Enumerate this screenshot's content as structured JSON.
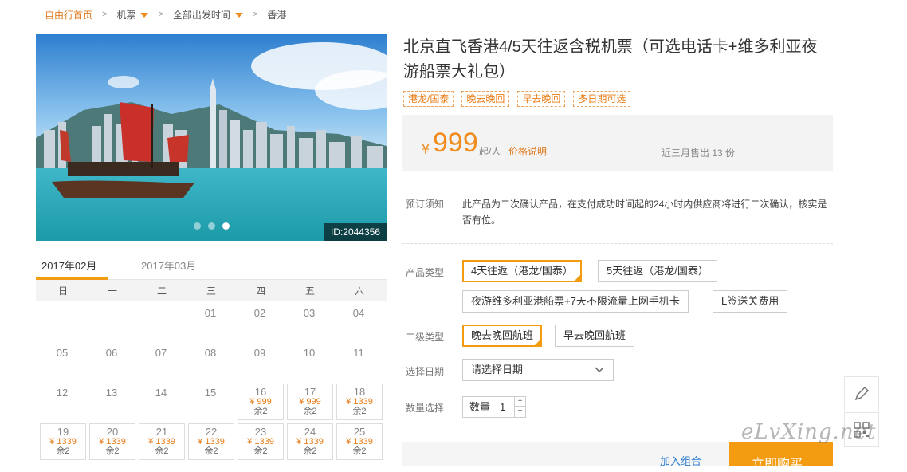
{
  "breadcrumb": {
    "home": "自由行首页",
    "flight": "机票",
    "departure": "全部出发时间",
    "destination": "香港"
  },
  "hero": {
    "id_label": "ID:2044356",
    "slides": 3,
    "active_slide": 3
  },
  "months": {
    "tabs": [
      "2017年02月",
      "2017年03月"
    ],
    "active": 0
  },
  "calendar": {
    "weekdays": [
      "日",
      "一",
      "二",
      "三",
      "四",
      "五",
      "六"
    ],
    "plain_days": [
      "01",
      "02",
      "03",
      "04",
      "05",
      "06",
      "07",
      "08",
      "09",
      "10",
      "11",
      "12",
      "13",
      "14",
      "15"
    ],
    "priced_days": [
      {
        "day": "16",
        "price": "¥ 999",
        "remain": "余2"
      },
      {
        "day": "17",
        "price": "¥ 999",
        "remain": "余2"
      },
      {
        "day": "18",
        "price": "¥ 1339",
        "remain": "余2"
      },
      {
        "day": "19",
        "price": "¥ 1339",
        "remain": "余2"
      },
      {
        "day": "20",
        "price": "¥ 1339",
        "remain": "余2"
      },
      {
        "day": "21",
        "price": "¥ 1339",
        "remain": "余2"
      },
      {
        "day": "22",
        "price": "¥ 1339",
        "remain": "余2"
      },
      {
        "day": "23",
        "price": "¥ 1339",
        "remain": "余2"
      },
      {
        "day": "24",
        "price": "¥ 1339",
        "remain": "余2"
      },
      {
        "day": "25",
        "price": "¥ 1339",
        "remain": "余2"
      }
    ]
  },
  "product": {
    "title": "北京直飞香港4/5天往返含税机票（可选电话卡+维多利亚夜游船票大礼包）",
    "tags": [
      "港龙/国泰",
      "晚去晚回",
      "早去晚回",
      "多日期可选"
    ],
    "price": {
      "currency": "¥",
      "amount": "999",
      "unit": "起/人",
      "note": "价格说明",
      "sold": "近三月售出 13 份"
    },
    "notice_label": "预订须知",
    "notice_text": "此产品为二次确认产品，在支付成功时间起的24小时内供应商将进行二次确认，核实是否有位。",
    "type_label": "产品类型",
    "types": [
      "4天往返（港龙/国泰）",
      "5天往返（港龙/国泰）",
      "夜游维多利亚港船票+7天不限流量上网手机卡",
      "L签送关费用"
    ],
    "subtype_label": "二级类型",
    "subtypes": [
      "晚去晚回航班",
      "早去晚回航班"
    ],
    "date_label": "选择日期",
    "date_placeholder": "请选择日期",
    "qty_label": "数量选择",
    "qty_text": "数量",
    "qty_value": "1",
    "add_combo": "加入组合",
    "buy_now": "立即购买"
  },
  "watermark": "eLvXing.net",
  "colors": {
    "accent": "#f39c12",
    "price": "#f08c1e",
    "link": "#2c7bd0"
  }
}
